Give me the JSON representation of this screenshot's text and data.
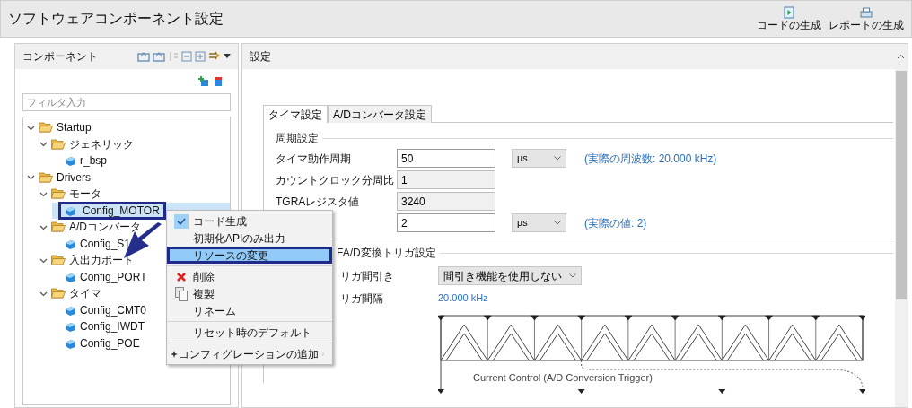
{
  "window": {
    "title": "ソフトウェアコンポーネント設定"
  },
  "toolbar_buttons": [
    {
      "label": "コードの生成",
      "kind": "code"
    },
    {
      "label": "レポートの生成",
      "kind": "report"
    }
  ],
  "left_panel": {
    "title": "コンポーネント",
    "filter": {
      "placeholder": "フィルタ入力"
    },
    "tree": [
      {
        "label": "Startup",
        "kind": "folder",
        "expanded": true,
        "selected": false,
        "children": [
          {
            "label": "ジェネリック",
            "kind": "folder",
            "expanded": true,
            "selected": false,
            "children": [
              {
                "label": "r_bsp",
                "kind": "component",
                "selected": false
              }
            ]
          }
        ]
      },
      {
        "label": "Drivers",
        "kind": "folder",
        "expanded": true,
        "selected": false,
        "children": [
          {
            "label": "モータ",
            "kind": "folder",
            "expanded": true,
            "selected": false,
            "children": [
              {
                "label": "Config_MOTOR",
                "kind": "component",
                "selected": true
              }
            ]
          },
          {
            "label": "A/Dコンバータ",
            "kind": "folder",
            "expanded": true,
            "selected": false,
            "children": [
              {
                "label": "Config_S1",
                "kind": "component",
                "selected": false
              }
            ]
          },
          {
            "label": "入出力ポート",
            "kind": "folder",
            "expanded": true,
            "selected": false,
            "children": [
              {
                "label": "Config_PORT",
                "kind": "component",
                "selected": false
              }
            ]
          },
          {
            "label": "タイマ",
            "kind": "folder",
            "expanded": true,
            "selected": false,
            "children": [
              {
                "label": "Config_CMT0",
                "kind": "component",
                "selected": false
              },
              {
                "label": "Config_IWDT",
                "kind": "component",
                "selected": false
              },
              {
                "label": "Config_POE",
                "kind": "component",
                "selected": false
              }
            ]
          }
        ]
      }
    ]
  },
  "right_panel": {
    "title": "設定",
    "tabs": [
      {
        "label": "タイマ設定",
        "selected": true
      },
      {
        "label": "A/Dコンバータ設定",
        "selected": false
      }
    ],
    "period_group": {
      "title": "周期設定",
      "rows": [
        {
          "label": "タイマ動作周期",
          "value": "50",
          "editable": true,
          "unit": "µs",
          "note": "(実際の周波数: 20.000 kHz)"
        },
        {
          "label": "カウントクロック分周比",
          "value": "1",
          "editable": false
        },
        {
          "label": "TGRAレジスタ値",
          "value": "3240",
          "editable": false
        },
        {
          "label": "",
          "value": "2",
          "editable": true,
          "unit": "µs",
          "note": "(実際の値: 2)"
        }
      ]
    },
    "trigger_group": {
      "title": "FA/D変換トリガ設定",
      "rows": [
        {
          "label": "リガ間引き",
          "kind": "select",
          "value": "間引き機能を使用しない"
        },
        {
          "label": "リガ間隔",
          "kind": "text",
          "value": "20.000 kHz"
        }
      ],
      "diagram_caption": "Current Control (A/D Conversion Trigger)"
    }
  },
  "context_menu": {
    "groups": [
      [
        {
          "label": "コード生成",
          "kind": "plain",
          "checked": true,
          "selected": false
        },
        {
          "label": "初期化APIのみ出力",
          "kind": "plain",
          "checked": false,
          "selected": false
        },
        {
          "label": "リソースの変更",
          "kind": "plain",
          "checked": false,
          "selected": true
        }
      ],
      [
        {
          "label": "削除",
          "kind": "delete",
          "checked": false,
          "selected": false
        },
        {
          "label": "複製",
          "kind": "duplicate",
          "checked": false,
          "selected": false
        },
        {
          "label": "リネーム",
          "kind": "plain",
          "checked": false,
          "selected": false
        }
      ],
      [
        {
          "label": "リセット時のデフォルト",
          "kind": "plain",
          "checked": false,
          "selected": false
        }
      ],
      [
        {
          "label": "コンフィグレーションの追加",
          "kind": "submenu",
          "checked": false,
          "selected": false
        }
      ]
    ]
  }
}
